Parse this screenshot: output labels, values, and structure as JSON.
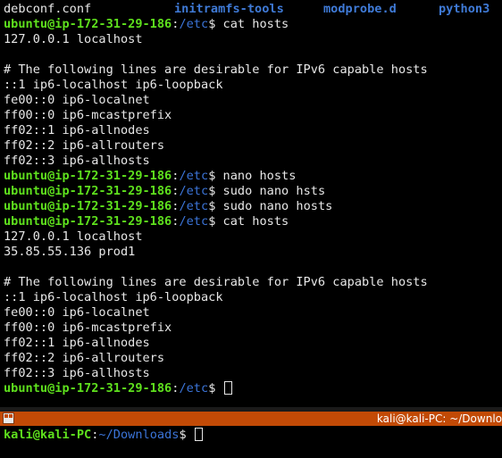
{
  "listing": {
    "col1": "debconf.conf",
    "col2": "initramfs-tools",
    "col3": "modprobe.d",
    "col4": "python3"
  },
  "prompt": {
    "user_host": "ubuntu@ip-172-31-29-186",
    "sep": ":",
    "path": "/etc",
    "dollar": "$"
  },
  "lines": [
    {
      "type": "cmd",
      "text": " cat hosts"
    },
    {
      "type": "out",
      "text": "127.0.0.1 localhost"
    },
    {
      "type": "out",
      "text": ""
    },
    {
      "type": "out",
      "text": "# The following lines are desirable for IPv6 capable hosts"
    },
    {
      "type": "out",
      "text": "::1 ip6-localhost ip6-loopback"
    },
    {
      "type": "out",
      "text": "fe00::0 ip6-localnet"
    },
    {
      "type": "out",
      "text": "ff00::0 ip6-mcastprefix"
    },
    {
      "type": "out",
      "text": "ff02::1 ip6-allnodes"
    },
    {
      "type": "out",
      "text": "ff02::2 ip6-allrouters"
    },
    {
      "type": "out",
      "text": "ff02::3 ip6-allhosts"
    },
    {
      "type": "cmd",
      "text": " nano hosts"
    },
    {
      "type": "cmd",
      "text": " sudo nano hsts"
    },
    {
      "type": "cmd",
      "text": " sudo nano hosts"
    },
    {
      "type": "cmd",
      "text": " cat hosts"
    },
    {
      "type": "out",
      "text": "127.0.0.1 localhost"
    },
    {
      "type": "out",
      "text": "35.85.55.136 prod1"
    },
    {
      "type": "out",
      "text": ""
    },
    {
      "type": "out",
      "text": "# The following lines are desirable for IPv6 capable hosts"
    },
    {
      "type": "out",
      "text": "::1 ip6-localhost ip6-loopback"
    },
    {
      "type": "out",
      "text": "fe00::0 ip6-localnet"
    },
    {
      "type": "out",
      "text": "ff00::0 ip6-mcastprefix"
    },
    {
      "type": "out",
      "text": "ff02::1 ip6-allnodes"
    },
    {
      "type": "out",
      "text": "ff02::2 ip6-allrouters"
    },
    {
      "type": "out",
      "text": "ff02::3 ip6-allhosts"
    },
    {
      "type": "cursor",
      "text": " "
    }
  ],
  "bottom_terminal": {
    "title": "kali@kali-PC: ~/Downlo",
    "user_host": "kali@kali-PC",
    "sep": ":",
    "path": "~/Downloads",
    "dollar": "$",
    "icon": "terminal-split-icon"
  },
  "colors": {
    "background": "#000000",
    "text": "#e7e7e7",
    "prompt_user": "#5ee01d",
    "prompt_path": "#3b74d8",
    "directory": "#3f7ad6",
    "titlebar": "#c24a06"
  }
}
